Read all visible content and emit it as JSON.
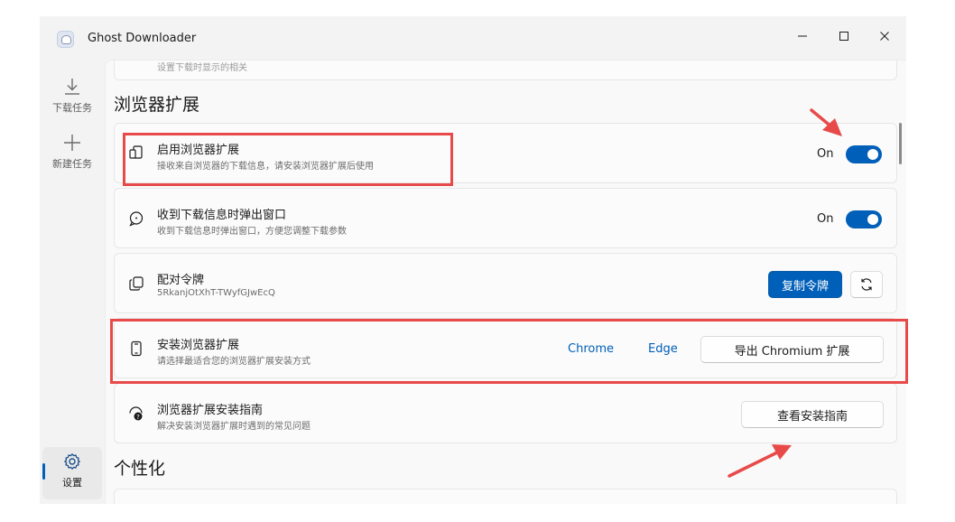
{
  "window": {
    "title": "Ghost Downloader"
  },
  "nav": {
    "items": [
      {
        "label": "下载任务",
        "icon": "download-icon"
      },
      {
        "label": "新建任务",
        "icon": "plus-icon"
      }
    ],
    "settings": {
      "label": "设置",
      "icon": "gear-icon"
    }
  },
  "top_card": {
    "desc": "设置下载时显示的相关"
  },
  "section_browser": {
    "title": "浏览器扩展"
  },
  "settings": {
    "enable_ext": {
      "title": "启用浏览器扩展",
      "desc": "接收来自浏览器的下载信息，请安装浏览器扩展后使用",
      "state": "On",
      "icon": "browser-extension-icon"
    },
    "popup": {
      "title": "收到下载信息时弹出窗口",
      "desc": "收到下载信息时弹出窗口，方便您调整下载参数",
      "state": "On",
      "icon": "chat-icon"
    },
    "token": {
      "title": "配对令牌",
      "value": "5RkanjOtXhT-TWyfGJwEcQ",
      "copy_label": "复制令牌",
      "icon": "copy-icon",
      "refresh_icon": "refresh-icon"
    },
    "install": {
      "title": "安装浏览器扩展",
      "desc": "请选择最适合您的浏览器扩展安装方式",
      "chrome_label": "Chrome",
      "edge_label": "Edge",
      "export_label": "导出 Chromium 扩展",
      "icon": "phone-icon"
    },
    "guide": {
      "title": "浏览器扩展安装指南",
      "desc": "解决安装浏览器扩展时遇到的常见问题",
      "button_label": "查看安装指南",
      "icon": "help-chat-icon"
    }
  },
  "section_personal": {
    "title": "个性化"
  },
  "colors": {
    "accent": "#005fb8",
    "annotation": "#e84a4a"
  }
}
